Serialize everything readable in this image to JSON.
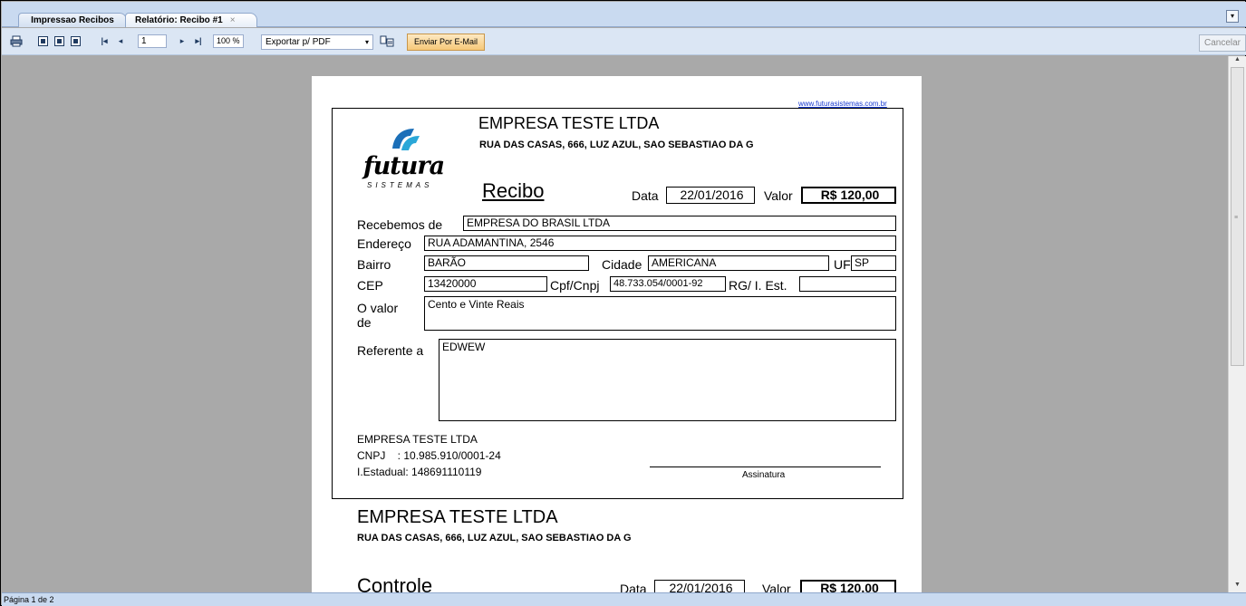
{
  "tabs": [
    {
      "label": "Impressao Recibos"
    },
    {
      "label": "Relatório: Recibo #1",
      "close": "×"
    }
  ],
  "tab_menu_icon": "▾",
  "toolbar": {
    "print_icon": "printer-icon",
    "view_icons": [
      "single-page-icon",
      "two-page-icon",
      "multi-page-icon"
    ],
    "first_icon": "|◂",
    "prev_icon": "◂",
    "page_value": "1",
    "next_icon": "▸",
    "last_icon": "▸|",
    "zoom_value": "100 %",
    "export_label": "Exportar p/ PDF",
    "export_arrow": "▾",
    "export_action_icon": "export-icon",
    "email_label": "Enviar Por E-Mail",
    "cancel_label": "Cancelar"
  },
  "status": {
    "text": "Página 1 de 2"
  },
  "page": {
    "site_url": "www.futurasistemas.com.br",
    "company_name": "EMPRESA TESTE LTDA",
    "company_address": "RUA DAS CASAS, 666, LUZ AZUL, SAO SEBASTIAO DA G",
    "logo_word": "futura",
    "logo_sub": "SISTEMAS",
    "receipt": {
      "title": "Recibo",
      "date_label": "Data",
      "date_value": "22/01/2016",
      "value_label": "Valor",
      "value": "R$ 120,00",
      "recebemos_label": "Recebemos de",
      "recebemos_value": "EMPRESA DO BRASIL LTDA",
      "endereco_label": "Endereço",
      "endereco_value": "RUA ADAMANTINA, 2546",
      "bairro_label": "Bairro",
      "bairro_value": "BARÃO",
      "cidade_label": "Cidade",
      "cidade_value": "AMERICANA",
      "uf_label": "UF",
      "uf_value": "SP",
      "cep_label": "CEP",
      "cep_value": "13420000",
      "cpf_label": "Cpf/Cnpj",
      "cpf_value": "48.733.054/0001-92",
      "rg_label": "RG/ I. Est.",
      "rg_value": "",
      "ovalor_label_1": "O valor",
      "ovalor_label_2": "de",
      "ovalor_value": "Cento e Vinte Reais",
      "referente_label": "Referente a",
      "referente_value": "EDWEW",
      "footer_company": "EMPRESA TESTE LTDA",
      "footer_cnpj": "CNPJ    : 10.985.910/0001-24",
      "footer_ie": "I.Estadual: 148691110119",
      "signature_label": "Assinatura"
    },
    "control": {
      "company_name": "EMPRESA TESTE LTDA",
      "company_address": "RUA DAS CASAS, 666, LUZ AZUL, SAO SEBASTIAO DA G",
      "title": "Controle",
      "date_label": "Data",
      "date_value": "22/01/2016",
      "value_label": "Valor",
      "value": "R$ 120,00"
    }
  },
  "scrollbar": {
    "up": "▲",
    "down": "▼",
    "grip": "≡"
  }
}
